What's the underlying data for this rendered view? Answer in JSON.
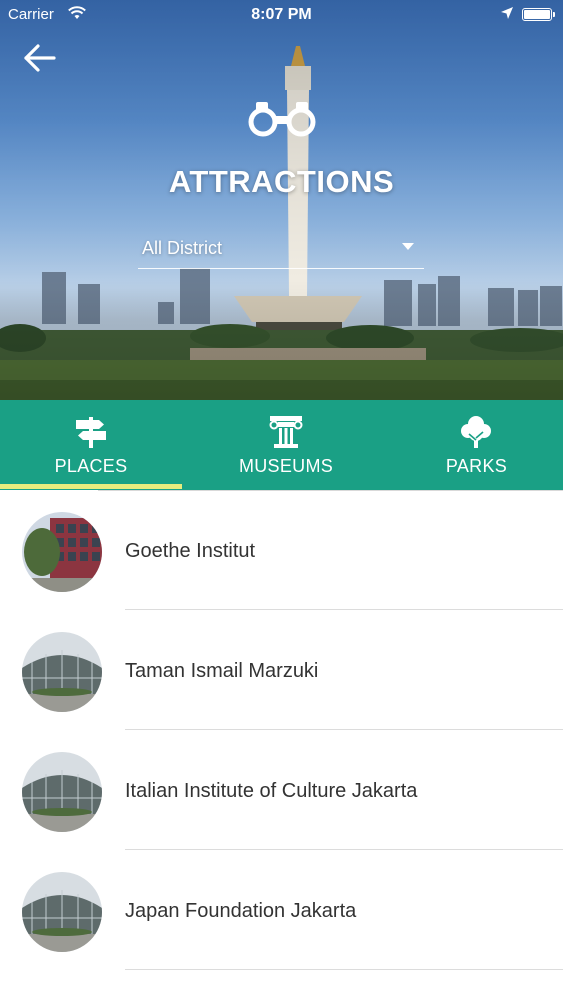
{
  "status_bar": {
    "carrier": "Carrier",
    "time": "8:07 PM"
  },
  "header": {
    "title": "ATTRACTIONS",
    "district_select": {
      "selected": "All District"
    },
    "back_icon": "arrow-left-icon",
    "logo_icon": "binoculars-icon"
  },
  "tabs": [
    {
      "label": "PLACES",
      "icon": "signpost-icon",
      "active": true
    },
    {
      "label": "MUSEUMS",
      "icon": "column-icon",
      "active": false
    },
    {
      "label": "PARKS",
      "icon": "tree-icon",
      "active": false
    }
  ],
  "colors": {
    "tab_bar": "#1aa085",
    "active_indicator": "#e8ec7e",
    "text": "#333333"
  },
  "places": [
    {
      "name": "Goethe Institut"
    },
    {
      "name": "Taman Ismail Marzuki"
    },
    {
      "name": "Italian Institute of Culture Jakarta"
    },
    {
      "name": "Japan Foundation Jakarta"
    }
  ]
}
